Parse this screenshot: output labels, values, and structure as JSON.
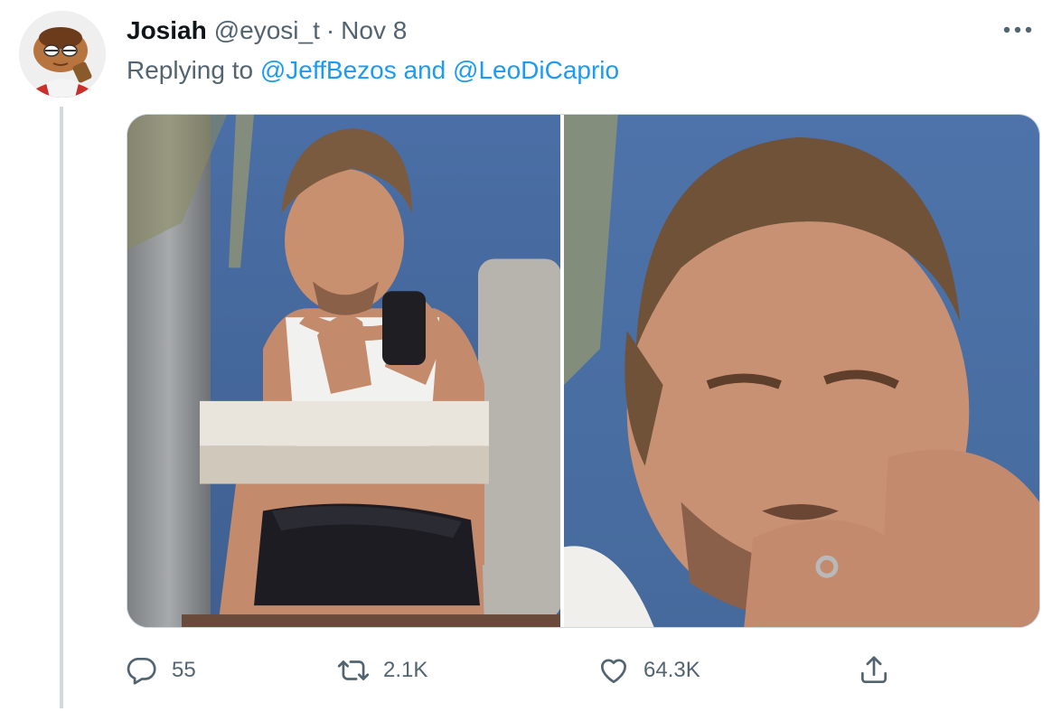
{
  "tweet": {
    "author_name": "Josiah",
    "author_handle": "@eyosi_t",
    "separator": "·",
    "date": "Nov 8",
    "reply_prefix": "Replying to",
    "reply_mentions": [
      "@JeffBezos",
      "@LeoDiCaprio"
    ],
    "reply_joiner": "and",
    "more_icon": "more-horizontal-icon"
  },
  "media": {
    "count": 2,
    "items": [
      {
        "name": "photo-man-with-phone-wide"
      },
      {
        "name": "photo-man-with-phone-closeup"
      }
    ]
  },
  "actions": {
    "reply": {
      "icon": "reply-bubble-icon",
      "count": "55"
    },
    "retweet": {
      "icon": "retweet-icon",
      "count": "2.1K"
    },
    "like": {
      "icon": "heart-icon",
      "count": "64.3K"
    },
    "share": {
      "icon": "share-icon"
    }
  },
  "colors": {
    "accent": "#1d9bf0",
    "secondary_text": "#536471",
    "primary_text": "#0f1419",
    "border": "#cfd9de"
  }
}
